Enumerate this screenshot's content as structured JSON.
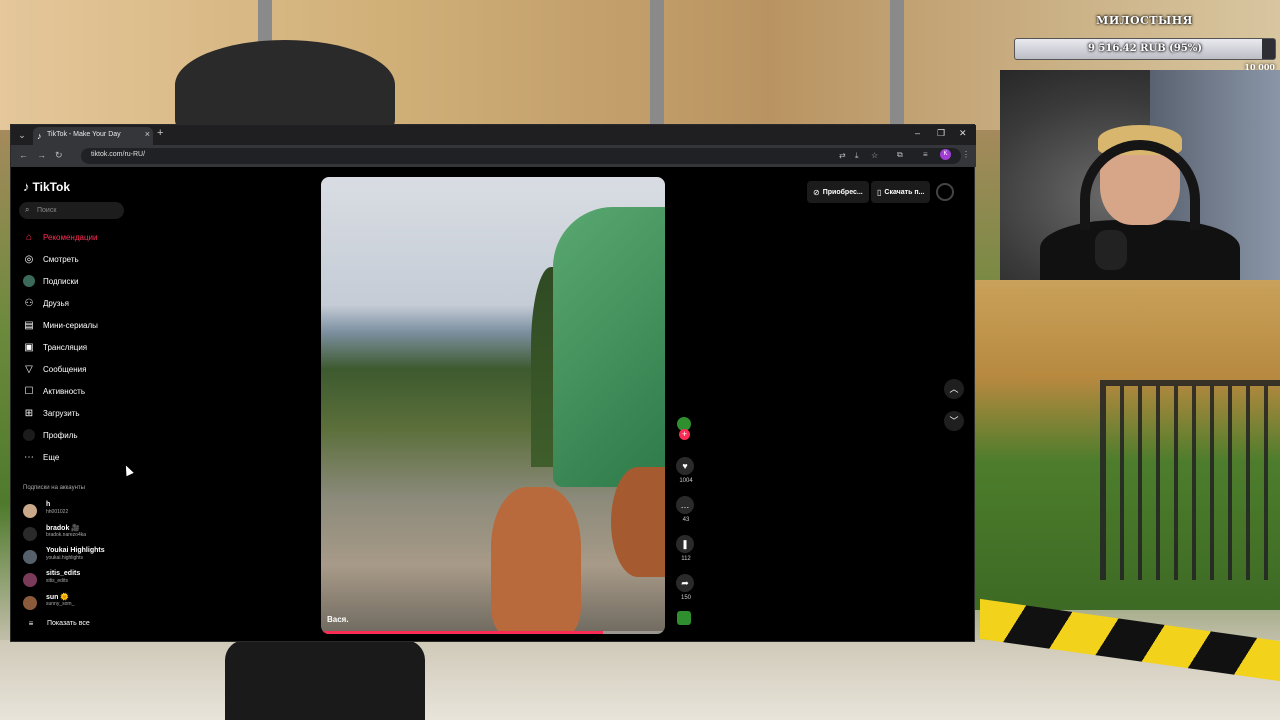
{
  "donation": {
    "title": "МИЛОСТЫНЯ",
    "amount": "9 516.42 RUB (95%)",
    "goal": "10 000",
    "progress": 0.95
  },
  "browser": {
    "tab_title": "TikTok - Make Your Day",
    "url": "tiktok.com/ru-RU/",
    "profile_initial": "K"
  },
  "tiktok": {
    "logo_text": "TikTok",
    "search_placeholder": "Поиск",
    "nav": [
      {
        "label": "Рекомендации",
        "icon": "home-icon"
      },
      {
        "label": "Смотреть",
        "icon": "compass-icon"
      },
      {
        "label": "Подписки",
        "icon": "following-icon"
      },
      {
        "label": "Друзья",
        "icon": "friends-icon"
      },
      {
        "label": "Мини-сериалы",
        "icon": "series-icon"
      },
      {
        "label": "Трансляция",
        "icon": "live-icon"
      },
      {
        "label": "Сообщения",
        "icon": "messages-icon"
      },
      {
        "label": "Активность",
        "icon": "activity-icon"
      },
      {
        "label": "Загрузить",
        "icon": "upload-icon"
      },
      {
        "label": "Профиль",
        "icon": "profile-icon"
      },
      {
        "label": "Еще",
        "icon": "more-icon"
      }
    ],
    "following_title": "Подписки на аккаунты",
    "accounts": [
      {
        "name": "h",
        "handle": "hh001022"
      },
      {
        "name": "bradok 🎥",
        "handle": "bradok.narezo4ka"
      },
      {
        "name": "Youkai Highlights",
        "handle": "youkai.highlights"
      },
      {
        "name": "sitis_edits",
        "handle": "sitis_edits"
      },
      {
        "name": "sun 🌞",
        "handle": "sunny_som_"
      }
    ],
    "show_all": "Показать все",
    "header": {
      "coins": "Приобрес...",
      "download": "Скачать п..."
    },
    "video": {
      "caption": "Вася.",
      "progress": 0.82
    },
    "actions": {
      "likes": "1004",
      "comments": "43",
      "saves": "112",
      "shares": "150"
    }
  }
}
